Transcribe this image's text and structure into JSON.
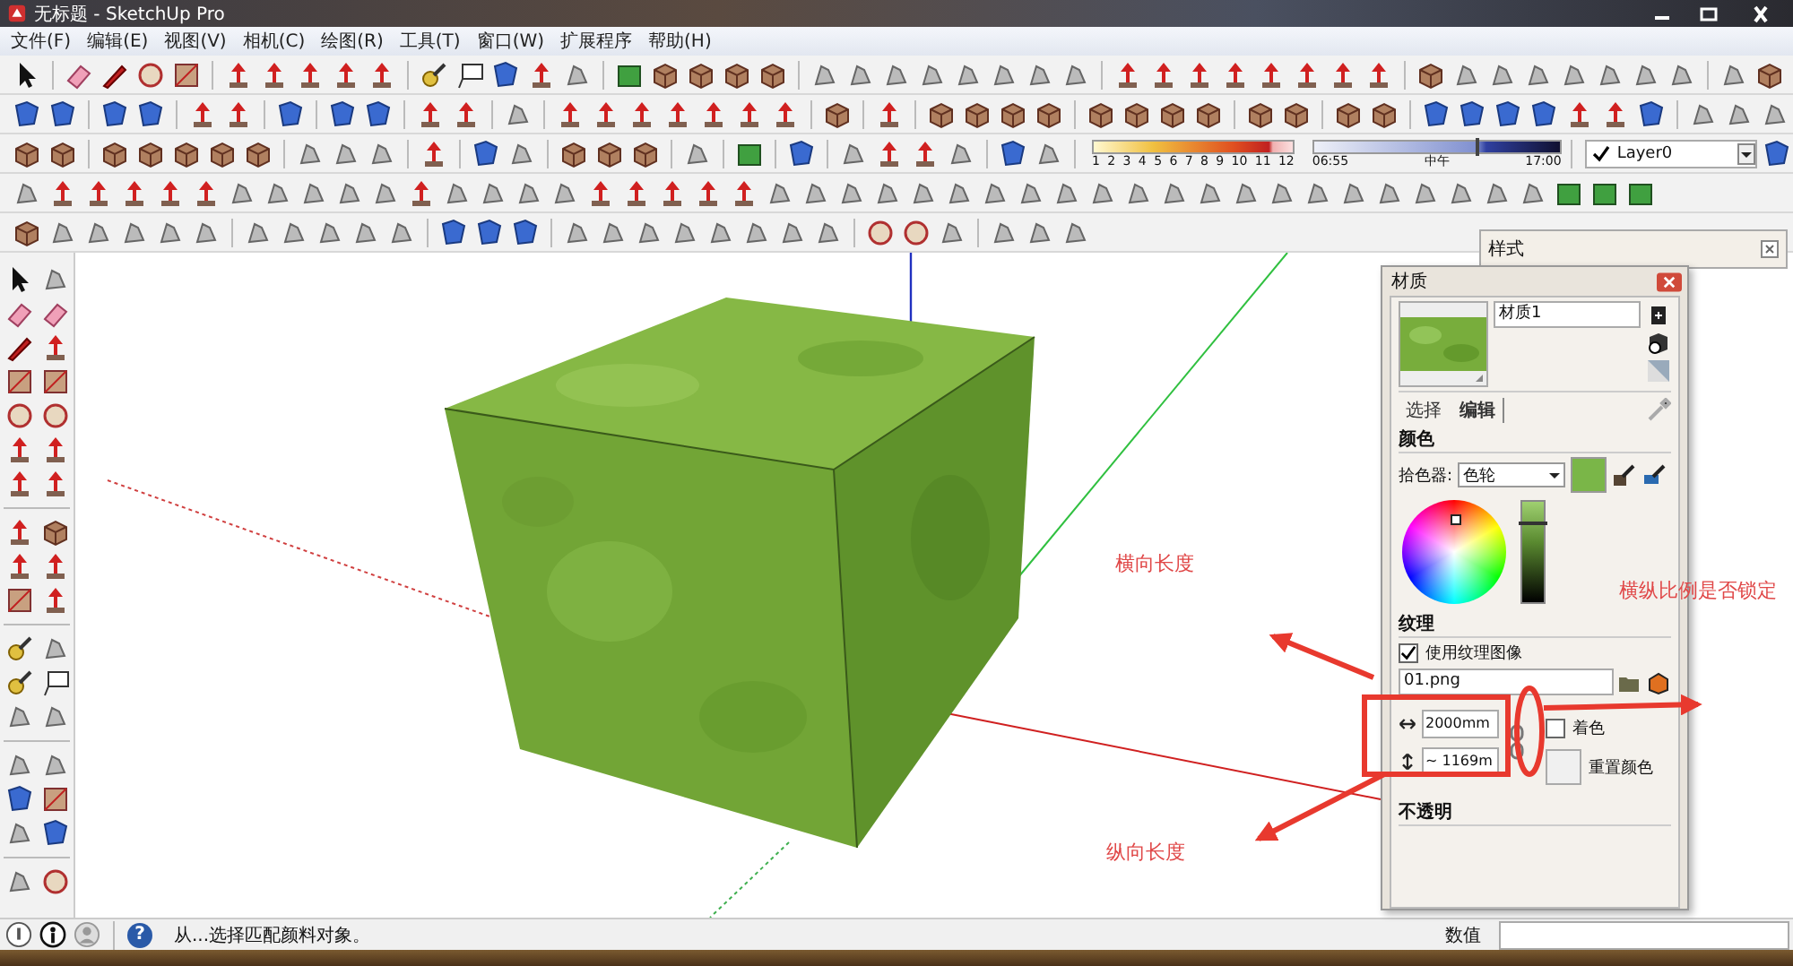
{
  "window": {
    "title": "无标题 - SketchUp Pro"
  },
  "menu": [
    "文件(F)",
    "编辑(E)",
    "视图(V)",
    "相机(C)",
    "绘图(R)",
    "工具(T)",
    "窗口(W)",
    "扩展程序",
    "帮助(H)"
  ],
  "shadow_scale": {
    "labels": [
      "1",
      "2",
      "3",
      "4",
      "5",
      "6",
      "7",
      "8",
      "9",
      "10",
      "11",
      "12"
    ]
  },
  "time_slider": {
    "start": "06:55",
    "middle": "中午",
    "end": "17:00",
    "level": 0.66
  },
  "layer_select": {
    "value": "Layer0",
    "checked": true
  },
  "annotations": [
    {
      "text": "横向长度"
    },
    {
      "text": "纵向长度"
    },
    {
      "text": "横纵比例是否锁定"
    }
  ],
  "styles_panel": {
    "title": "样式"
  },
  "materials_panel": {
    "title": "材质",
    "name": "材质1",
    "tabs": [
      {
        "label": "选择",
        "selected": false
      },
      {
        "label": "编辑",
        "selected": true
      }
    ],
    "color_heading": "颜色",
    "picker_label": "拾色器:",
    "picker_value": "色轮",
    "brightness_slider": {
      "level": 0.8
    },
    "texture_heading": "纹理",
    "use_texture": {
      "label": "使用纹理图像",
      "checked": true
    },
    "texture_file": "01.png",
    "width": "2000mm",
    "height": "~ 1169m",
    "colorize": {
      "label": "着色",
      "checked": false
    },
    "reset_label": "重置颜色",
    "opacity_heading": "不透明"
  },
  "status_bar": {
    "help": "?",
    "message": "从...选择匹配颜料对象。",
    "value_label": "数值"
  }
}
